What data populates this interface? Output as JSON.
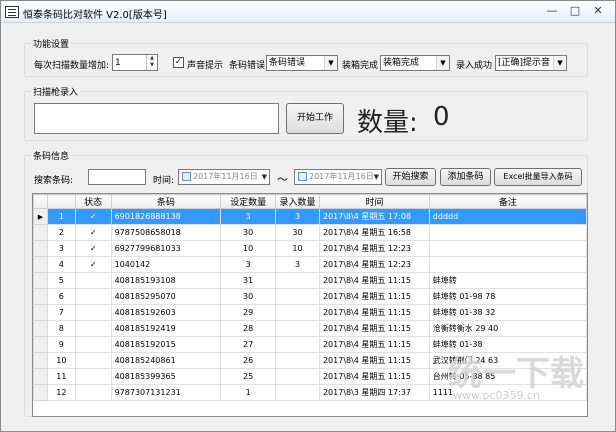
{
  "window": {
    "title": "恒泰条码比对软件 V2.0[版本号]"
  },
  "settings": {
    "title": "功能设置",
    "scan_increment_label": "每次扫描数量增加:",
    "scan_increment_value": "1",
    "sound_label": "声音提示",
    "sound_checked": "✓",
    "barcode_error_label": "条码错误",
    "barcode_error_value": "条码错误",
    "box_complete_label": "装箱完成",
    "box_complete_value": "装箱完成",
    "entry_success_label": "录入成功",
    "entry_success_value": "[正确]提示音"
  },
  "scanner": {
    "title": "扫描枪录入",
    "input_value": "",
    "start_button": "开始工作",
    "quantity_label": "数量:",
    "quantity_value": "0"
  },
  "barcode_info": {
    "title": "条码信息",
    "search_label": "搜索条码:",
    "search_value": "",
    "time_label": "时间:",
    "date_from": "2017年11月16日",
    "tilde": "～",
    "date_to": "2017年11月16日",
    "search_button": "开始搜索",
    "add_button": "添加条码",
    "import_button": "Excel批量导入条码"
  },
  "table": {
    "columns": [
      "状态",
      "条码",
      "设定数量",
      "录入数量",
      "时间",
      "备注"
    ],
    "rows": [
      {
        "no": "1",
        "status": "✓",
        "barcode": "6901826888138",
        "set_qty": "3",
        "entered_qty": "3",
        "time": "2017\\8\\4 星期五 17:08",
        "remark": "ddddd",
        "selected": true
      },
      {
        "no": "2",
        "status": "✓",
        "barcode": "9787508658018",
        "set_qty": "30",
        "entered_qty": "30",
        "time": "2017\\8\\4 星期五 16:58",
        "remark": ""
      },
      {
        "no": "3",
        "status": "✓",
        "barcode": "6927799681033",
        "set_qty": "10",
        "entered_qty": "10",
        "time": "2017\\8\\4 星期五 12:23",
        "remark": ""
      },
      {
        "no": "4",
        "status": "✓",
        "barcode": "1040142",
        "set_qty": "3",
        "entered_qty": "3",
        "time": "2017\\8\\4 星期五 12:23",
        "remark": ""
      },
      {
        "no": "5",
        "status": "",
        "barcode": "408185193108",
        "set_qty": "31",
        "entered_qty": "",
        "time": "2017\\8\\4 星期五 11:15",
        "remark": "蚌埠转"
      },
      {
        "no": "6",
        "status": "",
        "barcode": "408185295070",
        "set_qty": "30",
        "entered_qty": "",
        "time": "2017\\8\\4 星期五 11:15",
        "remark": "蚌埠转 01-98 78"
      },
      {
        "no": "7",
        "status": "",
        "barcode": "408185192603",
        "set_qty": "29",
        "entered_qty": "",
        "time": "2017\\8\\4 星期五 11:15",
        "remark": "蚌埠转 01-38 32"
      },
      {
        "no": "8",
        "status": "",
        "barcode": "408185192419",
        "set_qty": "28",
        "entered_qty": "",
        "time": "2017\\8\\4 星期五 11:15",
        "remark": "沧衡转衡水 29 40"
      },
      {
        "no": "9",
        "status": "",
        "barcode": "408185192015",
        "set_qty": "27",
        "entered_qty": "",
        "time": "2017\\8\\4 星期五 11:15",
        "remark": "蚌埠转 01-38"
      },
      {
        "no": "10",
        "status": "",
        "barcode": "408185240861",
        "set_qty": "26",
        "entered_qty": "",
        "time": "2017\\8\\4 星期五 11:15",
        "remark": "武汉转荆门 24 63"
      },
      {
        "no": "11",
        "status": "",
        "barcode": "408185399365",
        "set_qty": "25",
        "entered_qty": "",
        "time": "2017\\8\\4 星期五 11:15",
        "remark": "台州转 05-88 85"
      },
      {
        "no": "12",
        "status": "",
        "barcode": "9787307131231",
        "set_qty": "1",
        "entered_qty": "",
        "time": "2017\\8\\3 星期四 17:37",
        "remark": "1111"
      }
    ]
  },
  "watermark": {
    "text": "统一下载",
    "url": "www.pc0359.cn"
  },
  "colors": {
    "selection": "#3399ff",
    "window_bg": "#f0f0f0"
  }
}
